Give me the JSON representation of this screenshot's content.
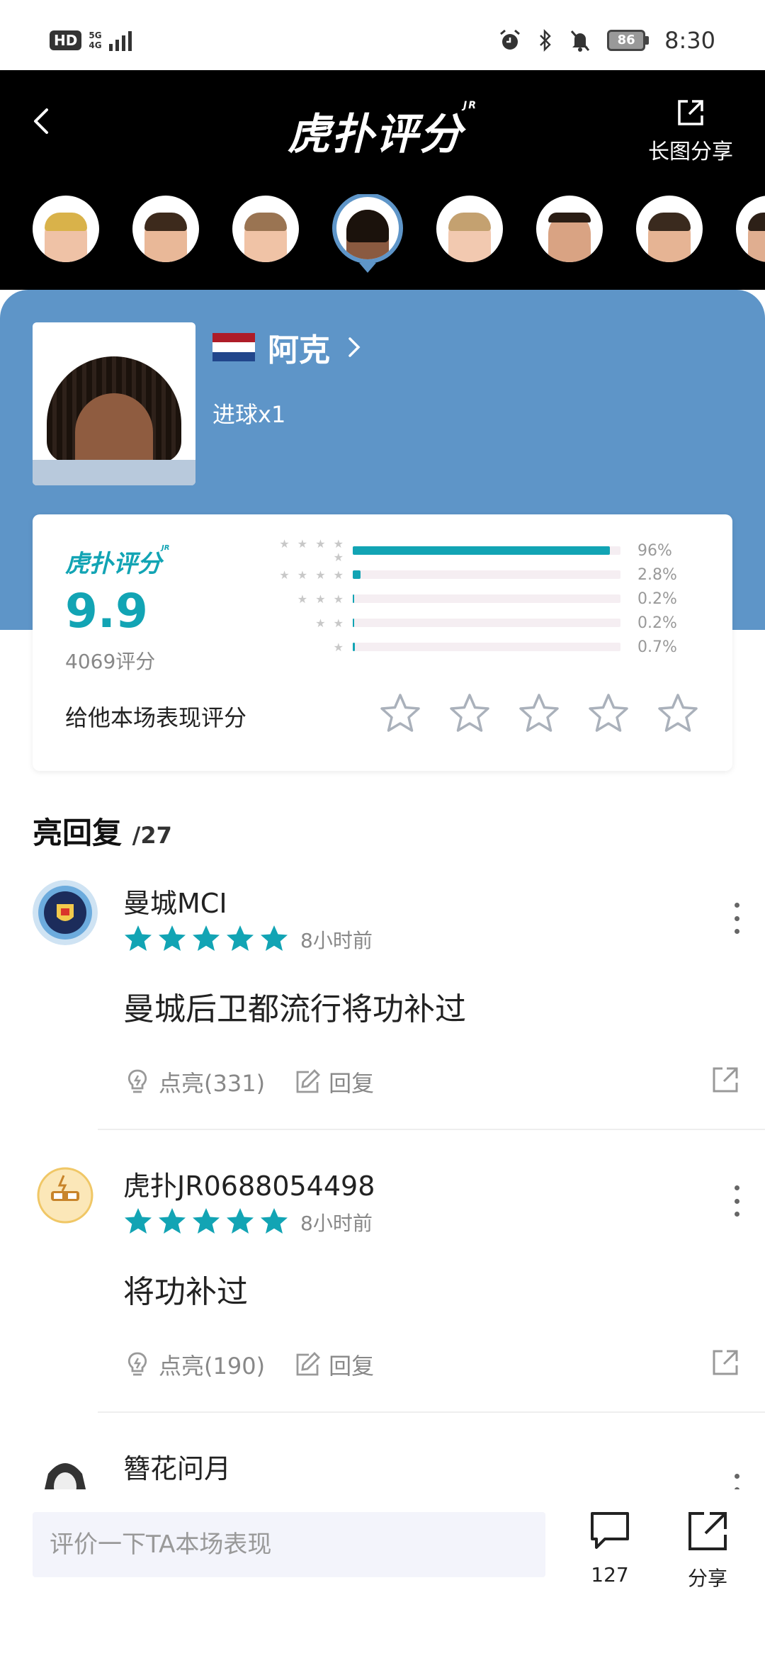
{
  "status_bar": {
    "hd": "HD",
    "network": "5G",
    "network_sub": "4G",
    "battery": "86",
    "time": "8:30"
  },
  "header": {
    "title": "虎扑评分",
    "title_mark": "JR",
    "share_long_label": "长图分享"
  },
  "player": {
    "name": "阿克",
    "stat": "进球x1",
    "flag_colors": [
      "#ae1c28",
      "#ffffff",
      "#21468b"
    ]
  },
  "rating": {
    "logo": "虎扑评分",
    "logo_mark": "JR",
    "score": "9.9",
    "count_label": "4069评分",
    "distribution": [
      {
        "stars": 5,
        "label": "★ ★ ★ ★ ★",
        "percent": 96,
        "percent_label": "96%"
      },
      {
        "stars": 4,
        "label": "★ ★ ★ ★",
        "percent": 2.8,
        "percent_label": "2.8%"
      },
      {
        "stars": 3,
        "label": "★ ★ ★",
        "percent": 0.2,
        "percent_label": "0.2%"
      },
      {
        "stars": 2,
        "label": "★ ★",
        "percent": 0.2,
        "percent_label": "0.2%"
      },
      {
        "stars": 1,
        "label": "★",
        "percent": 0.7,
        "percent_label": "0.7%"
      }
    ],
    "rate_prompt": "给他本场表现评分",
    "rate_star_count": 5
  },
  "replies_section": {
    "title": "亮回复",
    "count": "/27"
  },
  "replies": [
    {
      "user": "曼城MCI",
      "stars": 5,
      "time": "8小时前",
      "text": "曼城后卫都流行将功补过",
      "like_label": "点亮(331)",
      "reply_label": "回复"
    },
    {
      "user": "虎扑JR0688054498",
      "stars": 5,
      "time": "8小时前",
      "text": "将功补过",
      "like_label": "点亮(190)",
      "reply_label": "回复"
    },
    {
      "user": "簪花问月"
    }
  ],
  "bottom_bar": {
    "input_placeholder": "评价一下TA本场表现",
    "comments_count": "127",
    "share_label": "分享"
  },
  "colors": {
    "accent": "#12a4b4",
    "panel_blue": "#5e95c8",
    "header_bg": "#000000"
  }
}
